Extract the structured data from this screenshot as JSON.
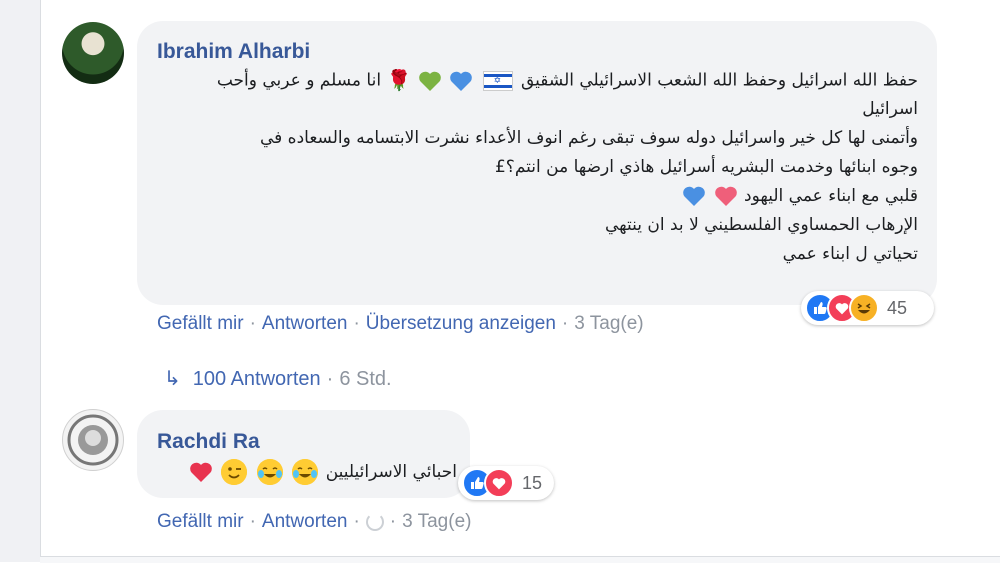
{
  "comments": [
    {
      "author": "Ibrahim Alharbi",
      "lines": [
        "حفظ الله اسرائيل وحفظ الله الشعب الاسرائيلي الشقيق",
        "انا مسلم و عربي وأحب",
        "اسرائيل",
        "وأتمنى لها كل خير واسرائيل دوله سوف تبقى رغم انوف الأعداء نشرت الابتسامه والسعاده في",
        "وجوه ابنائها وخدمت البشريه أسرائيل هاذي ارضها من انتم؟£",
        "قلبي مع ابناء عمي اليهود",
        "الإرهاب الحمساوي الفلسطيني لا بد ان ينتهي",
        "تحياتي ل ابناء عمي"
      ],
      "reaction_count": "45",
      "actions": {
        "like": "Gefällt mir",
        "reply": "Antworten",
        "translate": "Übersetzung anzeigen",
        "time": "3 Tag(e)"
      }
    },
    {
      "author": "Rachdi Ra",
      "text": "احبائي الاسرائيليين",
      "reaction_count": "15",
      "actions": {
        "like": "Gefällt mir",
        "reply": "Antworten",
        "time": "3 Tag(e)"
      }
    }
  ],
  "replies_link": {
    "label": "100 Antworten",
    "time": "6 Std."
  },
  "separator": "·",
  "icons": [
    "reply-arrow-icon",
    "like-icon",
    "love-icon",
    "haha-icon",
    "blue-heart-icon",
    "green-heart-icon",
    "red-heart-icon",
    "israel-flag-icon",
    "rose-icon",
    "wink-icon",
    "laughing-tears-icon",
    "loading-spinner-icon"
  ],
  "colors": {
    "link": "#4267b2",
    "author": "#385898",
    "bubble": "#f2f3f5",
    "meta": "#8d949e"
  }
}
